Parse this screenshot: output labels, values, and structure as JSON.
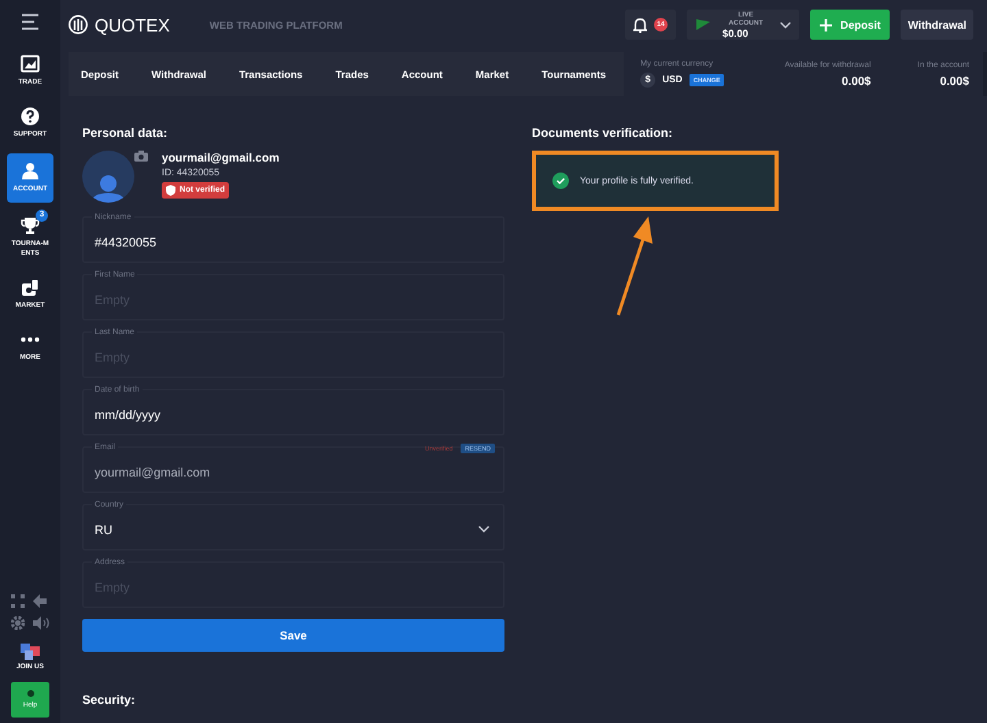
{
  "brand": {
    "name": "QUOTEX",
    "tagline": "WEB TRADING PLATFORM"
  },
  "sidebar": {
    "items": [
      {
        "label": "TRADE",
        "kind": "chart",
        "selected": false
      },
      {
        "label": "SUPPORT",
        "kind": "support",
        "selected": false
      },
      {
        "label": "ACCOUNT",
        "kind": "profile",
        "selected": true
      },
      {
        "label": "TOURNA-MENTS",
        "kind": "tournaments",
        "selected": false,
        "badge": "3"
      },
      {
        "label": "MARKET",
        "kind": "market",
        "selected": false
      },
      {
        "label": "MORE",
        "kind": "more",
        "selected": false
      }
    ],
    "join_label": "JOIN US",
    "help_label": "Help"
  },
  "header": {
    "notifications": "14",
    "account_label": "LIVE ACCOUNT",
    "balance": "$0.00",
    "deposit": "Deposit",
    "withdrawal": "Withdrawal"
  },
  "tabs": [
    {
      "label": "Deposit",
      "selected": false
    },
    {
      "label": "Withdrawal",
      "selected": false
    },
    {
      "label": "Transactions",
      "selected": false
    },
    {
      "label": "Trades",
      "selected": false
    },
    {
      "label": "Account",
      "selected": false
    },
    {
      "label": "Market",
      "selected": false
    },
    {
      "label": "Tournaments",
      "selected": false
    }
  ],
  "currency": {
    "label": "My current currency",
    "symbol": "$",
    "code": "USD",
    "change": "CHANGE"
  },
  "stats": [
    {
      "label": "Available for withdrawal",
      "value": "0.00$"
    },
    {
      "label": "In the account",
      "value": "0.00$"
    }
  ],
  "personal": {
    "title": "Personal data:",
    "email": "yourmail@gmail.com",
    "id": "ID: 44320055",
    "status": "Not verified",
    "fields": [
      {
        "kind": "text",
        "label": "Nickname",
        "value": "#44320055"
      },
      {
        "kind": "text",
        "label": "First Name",
        "placeholder": "Empty"
      },
      {
        "kind": "text",
        "label": "Last Name",
        "placeholder": "Empty"
      },
      {
        "kind": "text",
        "label": "Date of birth",
        "value": "mm/dd/yyyy"
      },
      {
        "kind": "email",
        "label": "Email",
        "value": "yourmail@gmail.com",
        "note": "Unverified",
        "action": "RESEND"
      },
      {
        "kind": "select",
        "label": "Country",
        "value": "RU"
      },
      {
        "kind": "text",
        "label": "Address",
        "placeholder": "Empty"
      }
    ],
    "save": "Save"
  },
  "documents": {
    "title": "Documents verification:",
    "message": "Your profile is fully verified.",
    "highlighted": true
  },
  "security": {
    "title": "Security:"
  }
}
